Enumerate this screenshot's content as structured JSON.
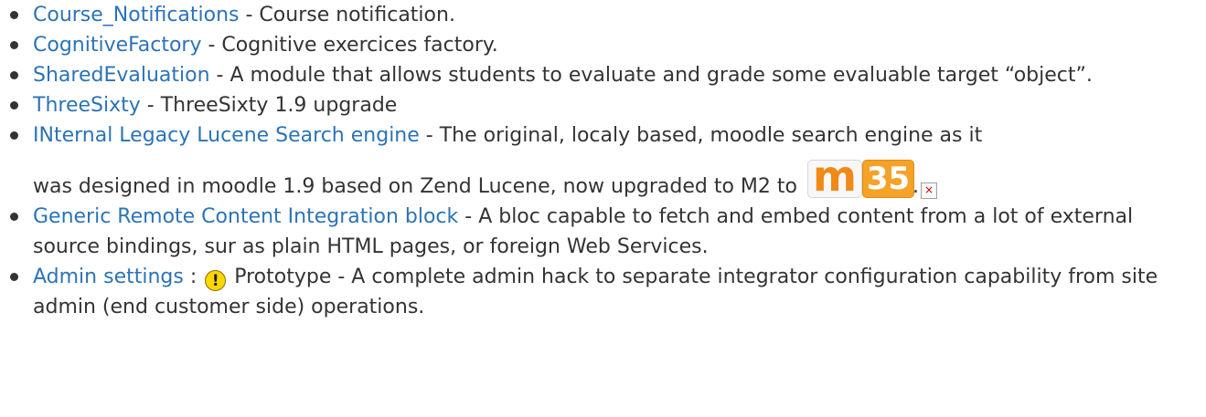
{
  "items": [
    {
      "link": "Course_Notifications",
      "text": " - Course notification."
    },
    {
      "link": "CognitiveFactory",
      "text": " - Cognitive exercices factory."
    },
    {
      "link": "SharedEvaluation",
      "text": " - A module that allows students to evaluate and grade some evaluable target “object”."
    },
    {
      "link": "ThreeSixty",
      "text": " - ThreeSixty 1.9 upgrade"
    },
    {
      "link": "INternal Legacy Lucene Search engine",
      "text": " - The original, localy based, moodle search engine as it",
      "text2": "was designed in moodle 1.9 based on Zend Lucene, now upgraded to M2 to ",
      "logo": {
        "letter": "m",
        "number": "35"
      },
      "after": "."
    },
    {
      "link": "Generic Remote Content Integration block",
      "text": " - A bloc capable to fetch and embed content from a lot of external source bindings, sur as plain HTML pages, or foreign Web Services."
    },
    {
      "link": "Admin settings",
      "sep": " : ",
      "icon": "warning-icon",
      "text": " Prototype - A complete admin hack to separate integrator configuration capability from site admin (end customer side) operations."
    }
  ],
  "colors": {
    "link": "#2b73b7",
    "text": "#333333",
    "logo_orange": "#f5a229"
  }
}
